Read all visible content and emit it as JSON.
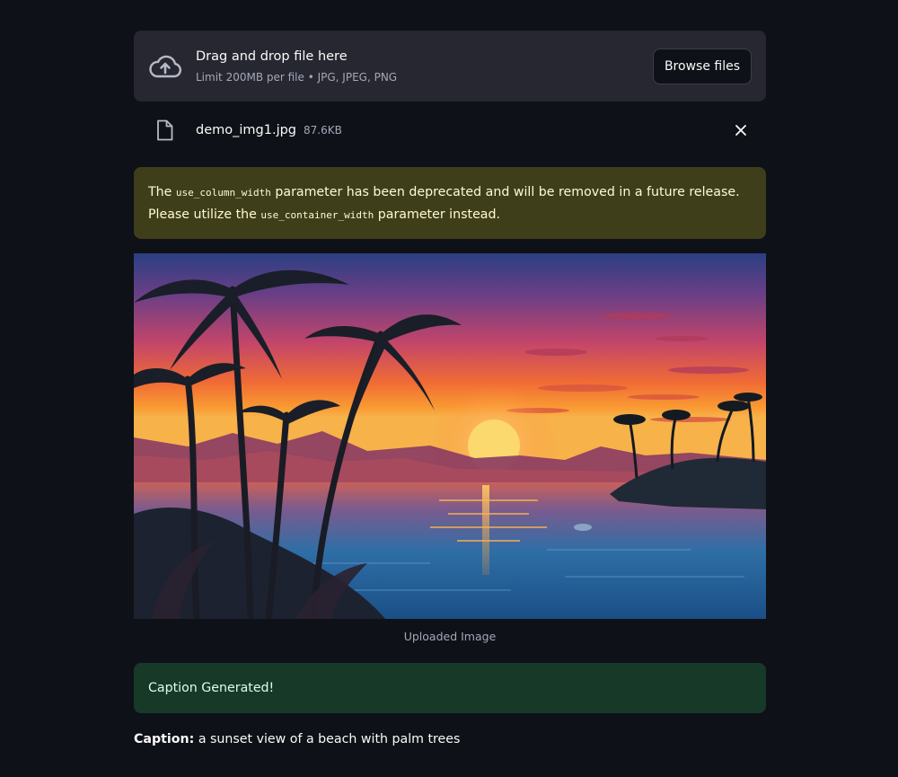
{
  "uploader": {
    "icon": "cloud-upload-icon",
    "title": "Drag and drop file here",
    "limit": "Limit 200MB per file • JPG, JPEG, PNG",
    "browse_label": "Browse files"
  },
  "file": {
    "icon": "file-icon",
    "name": "demo_img1.jpg",
    "size": "87.6KB",
    "remove_icon": "close-icon"
  },
  "warning": {
    "part1": "The ",
    "code1": "use_column_width",
    "part2": " parameter has been deprecated and will be removed in a future release. Please utilize the ",
    "code2": "use_container_width",
    "part3": " parameter instead."
  },
  "image": {
    "caption": "Uploaded Image"
  },
  "success": {
    "message": "Caption Generated!"
  },
  "result": {
    "label": "Caption:",
    "text": " a sunset view of a beach with palm trees"
  },
  "colors": {
    "background": "#0e1117",
    "dropzone": "#262730",
    "warning_bg": "#3f3e1a",
    "warning_text": "#fffbd2",
    "success_bg": "#173928",
    "success_text": "#dffde9"
  }
}
